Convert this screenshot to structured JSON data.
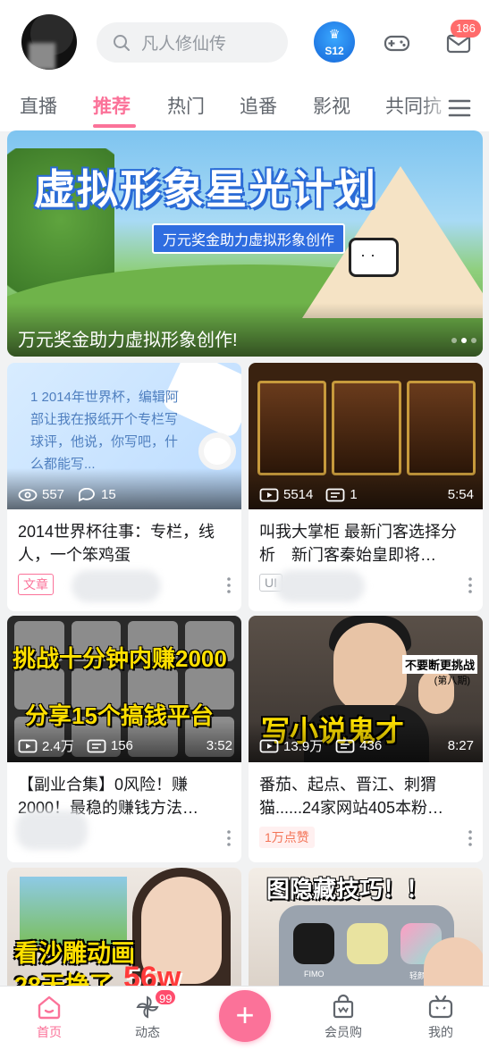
{
  "header": {
    "search_placeholder": "凡人修仙传",
    "game_badge": "S12",
    "mail_count": "186"
  },
  "tabs": [
    {
      "label": "直播"
    },
    {
      "label": "推荐"
    },
    {
      "label": "热门"
    },
    {
      "label": "追番"
    },
    {
      "label": "影视"
    },
    {
      "label": "共同抗"
    }
  ],
  "banner": {
    "title": "虚拟形象星光计划",
    "subtitle": "万元奖金助力虚拟形象创作",
    "caption": "万元奖金助力虚拟形象创作!"
  },
  "cards": [
    {
      "thumb_text": "1 2014年世界杯，编辑阿部让我在报纸开个专栏写球评，他说，你写吧，什么都能写...",
      "views": "557",
      "comments": "15",
      "duration": "",
      "title": "2014世界杯往事：专栏，线人，一个笨鸡蛋",
      "tag": "文章"
    },
    {
      "views": "5514",
      "comments": "1",
      "duration": "5:54",
      "title": "叫我大掌柜 最新门客选择分析　新门客秦始皇即将…",
      "tag": "UI"
    },
    {
      "thumb_line1": "挑战十分钟内赚2000",
      "thumb_line2": "分享15个搞钱平台",
      "views": "2.4万",
      "comments": "156",
      "duration": "3:52",
      "title": "【副业合集】0风险！赚2000！最稳的赚钱方法…",
      "tag": ""
    },
    {
      "thumb_side1": "不要断更挑战",
      "thumb_side2": "(第八期)",
      "thumb_big": "写小说鬼才",
      "views": "13.9万",
      "comments": "436",
      "duration": "8:27",
      "title": "番茄、起点、晋江、刺猬猫......24家网站405本粉…",
      "tag": "1万点赞"
    },
    {
      "thumb_line1": "看沙雕动画",
      "thumb_line2": "28天挣了",
      "thumb_big": "56w"
    },
    {
      "thumb_head": "图隐藏技巧！！",
      "app_labels": [
        "FIMO",
        "轻颜"
      ]
    }
  ],
  "bottom_nav": {
    "home": "首页",
    "dynamic": "动态",
    "dynamic_badge": "99",
    "shop": "会员购",
    "mine": "我的"
  },
  "colors": {
    "accent": "#fb7299",
    "text": "#18191c",
    "muted": "#9499a0"
  }
}
